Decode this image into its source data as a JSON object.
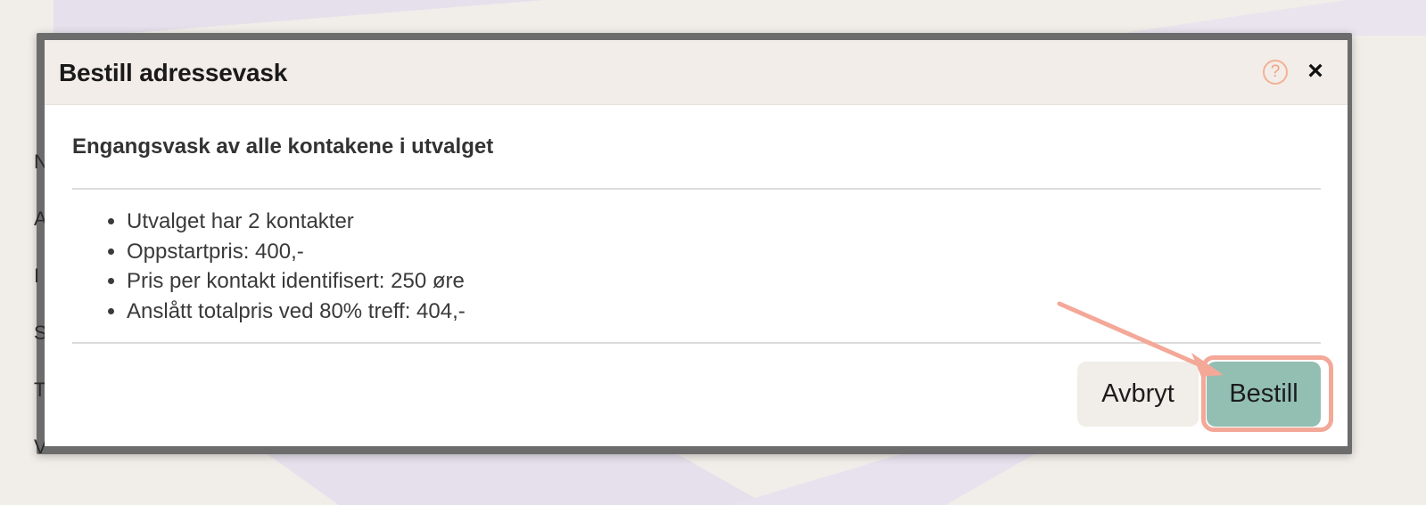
{
  "dialog": {
    "title": "Bestill adressevask",
    "help_glyph": "?",
    "close_glyph": "×",
    "subtitle": "Engangsvask av alle kontakene i utvalget",
    "info_items": [
      "Utvalget har 2 kontakter",
      "Oppstartpris: 400,-",
      "Pris per kontakt identifisert: 250 øre",
      "Anslått totalpris ved 80% treff: 404,-"
    ],
    "buttons": {
      "cancel_label": "Avbryt",
      "order_label": "Bestill"
    }
  },
  "icons": {
    "help": "help-circle-icon",
    "close": "close-icon",
    "annotation": "arrow-annotation"
  },
  "colors": {
    "header_bg": "#f2ede8",
    "primary_button": "#93bfb3",
    "secondary_button": "#f1ede8",
    "annotation": "#f4a898",
    "help_icon": "#f2a07e"
  }
}
